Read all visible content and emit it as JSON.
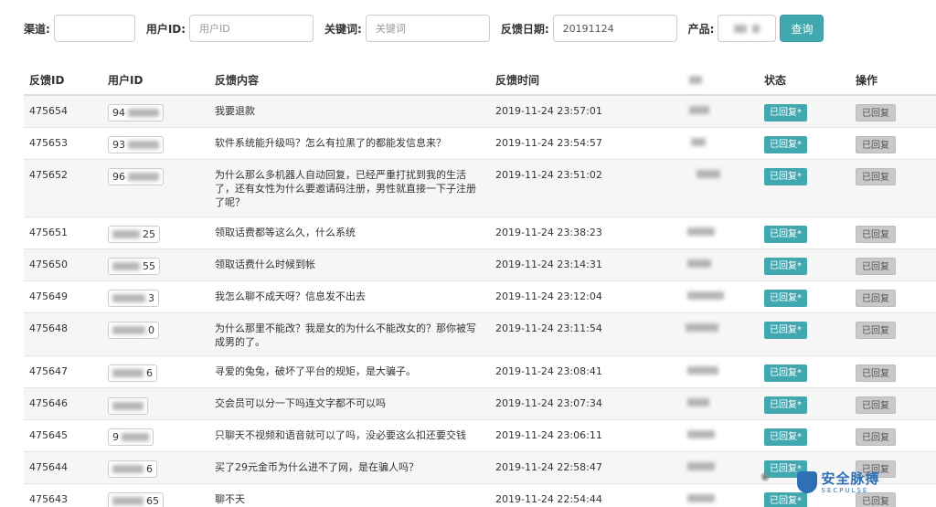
{
  "filters": {
    "channel_label": "渠道:",
    "channel_value": "",
    "userid_label": "用户ID:",
    "userid_placeholder": "用户ID",
    "keyword_label": "关键词:",
    "keyword_placeholder": "关键词",
    "date_label": "反馈日期:",
    "date_value": "20191124",
    "product_label": "产品:",
    "query_label": "查询"
  },
  "table": {
    "headers": [
      "反馈ID",
      "用户ID",
      "反馈内容",
      "反馈时间",
      "",
      "状态",
      "操作"
    ],
    "rows": [
      {
        "id": "475654",
        "uid": "94",
        "content": "我要退款",
        "time": "2019-11-24 23:57:01",
        "status": "已回复*",
        "op": "已回复"
      },
      {
        "id": "475653",
        "uid": "93",
        "content": "软件系统能升级吗？怎么有拉黑了的都能发信息来？",
        "time": "2019-11-24 23:54:57",
        "status": "已回复*",
        "op": "已回复"
      },
      {
        "id": "475652",
        "uid": "96",
        "content": "为什么那么多机器人自动回复，已经严重打扰到我的生活了，还有女性为什么要邀请码注册，男性就直接一下子注册了呢？",
        "time": "2019-11-24 23:51:02",
        "status": "已回复*",
        "op": "已回复"
      },
      {
        "id": "475651",
        "uid": "25",
        "content": "领取话费都等这么久，什么系统",
        "time": "2019-11-24 23:38:23",
        "status": "已回复*",
        "op": "已回复"
      },
      {
        "id": "475650",
        "uid": "55",
        "content": "领取话费什么时候到帐",
        "time": "2019-11-24 23:14:31",
        "status": "已回复*",
        "op": "已回复"
      },
      {
        "id": "475649",
        "uid": "3",
        "content": "我怎么聊不成天呀？信息发不出去",
        "time": "2019-11-24 23:12:04",
        "status": "已回复*",
        "op": "已回复"
      },
      {
        "id": "475648",
        "uid": "0",
        "content": "为什么那里不能改？我是女的为什么不能改女的？那你被写成男的了。",
        "time": "2019-11-24 23:11:54",
        "status": "已回复*",
        "op": "已回复"
      },
      {
        "id": "475647",
        "uid": "6",
        "content": "寻爱的兔兔，破坏了平台的规矩，是大骗子。",
        "time": "2019-11-24 23:08:41",
        "status": "已回复*",
        "op": "已回复"
      },
      {
        "id": "475646",
        "uid": "",
        "content": "交会员可以分一下吗连文字都不可以吗",
        "time": "2019-11-24 23:07:34",
        "status": "已回复*",
        "op": "已回复"
      },
      {
        "id": "475645",
        "uid": "9",
        "content": "只聊天不视频和语音就可以了吗，没必要这么扣还要交钱",
        "time": "2019-11-24 23:06:11",
        "status": "已回复*",
        "op": "已回复"
      },
      {
        "id": "475644",
        "uid": "6",
        "content": "买了29元金币为什么进不了网，是在骗人吗？",
        "time": "2019-11-24 22:58:47",
        "status": "已回复*",
        "op": "已回复"
      },
      {
        "id": "475643",
        "uid": "65",
        "content": "聊不天",
        "time": "2019-11-24 22:54:44",
        "status": "已回复*",
        "op": "已回复"
      }
    ]
  },
  "watermark": {
    "main": "安全脉搏",
    "sub": "SECPULSE"
  },
  "colors": {
    "accent": "#42a8b0",
    "op_button": "#c9c9c9",
    "row_alt": "#f6f6f6",
    "watermark_blue": "#2f6fb5"
  }
}
